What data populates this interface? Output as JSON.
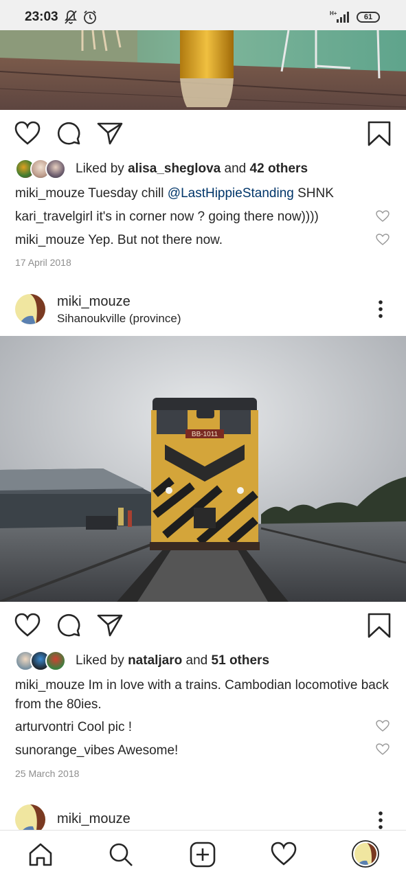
{
  "status_bar": {
    "time": "23:03",
    "network": "H+",
    "battery": "61"
  },
  "post1": {
    "liked_by_prefix": "Liked by",
    "liked_by_user": "alisa_sheglova",
    "liked_and": "and",
    "liked_others": "42 others",
    "caption": {
      "user": "miki_mouze",
      "text_before": " Tuesday chill ",
      "mention": "@LastHippieStanding",
      "text_after": " SHNK"
    },
    "comments": [
      {
        "user": "kari_travelgirl",
        "text": " it's in corner now ? going there now))))"
      },
      {
        "user": "miki_mouze",
        "text": " Yep. But not there now."
      }
    ],
    "date": "17 April 2018"
  },
  "post2": {
    "username": "miki_mouze",
    "location": "Sihanoukville (province)",
    "train_plate": "BB-1011",
    "liked_by_prefix": "Liked by",
    "liked_by_user": "nataljaro",
    "liked_and": "and",
    "liked_others": "51 others",
    "caption": {
      "user": "miki_mouze",
      "text": " Im in love with a trains. Cambodian locomotive back from the 80ies."
    },
    "comments": [
      {
        "user": "arturvontri",
        "text": " Cool pic !"
      },
      {
        "user": "sunorange_vibes",
        "text": " Awesome!"
      }
    ],
    "date": "25 March 2018"
  },
  "post3": {
    "username": "miki_mouze"
  },
  "nav": {
    "items": [
      "home-icon",
      "search-icon",
      "add-post-icon",
      "activity-heart-icon",
      "profile-avatar"
    ]
  }
}
